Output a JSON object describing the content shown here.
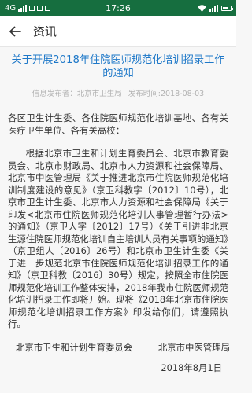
{
  "status_bar": {
    "network": "4G",
    "time": "17:26"
  },
  "app_bar": {
    "title": "资讯"
  },
  "article": {
    "title": "关于开展2018年住院医师规范化培训招录工作的通知",
    "publisher": "信息发布者：北京市卫生局",
    "publish_time": "发布时间:2018-08-03",
    "paragraphs": [
      "各区卫生计生委、各住院医师规范化培训基地、各有关医疗卫生单位、各有关高校：",
      "根据北京市卫生和计划生育委员会、北京市教育委员会、北京市财政局、北京市人力资源和社会保障局、北京市中医管理局《关于推进北京市住院医师规范化培训制度建设的意见》（京卫科教字〔2012〕10号），北京市卫生计生委、北京市人力资源和社会保障局《关于印发<北京市住院医师规范化培训人事管理暂行办法>的通知》（京卫人字〔2012〕17号）《关于引进非北京生源住院医师规范化培训自主培训人员有关事项的通知》（京卫组人〔2016〕26号）和北京市卫生计生委《关于进一步规范北京市住院医师规范化培训招录工作的通知》（京卫科教〔2016〕30号）规定，按照全市住院医师规范化培训工作整体安排，2018年我市住院医师规范化培训招录工作即将开始。现将《2018年北京市住院医师规范化培训招录工作方案》印发给你们，请遵照执行。"
    ],
    "signer_1": "北京市卫生和计划生育委员会",
    "signer_2": "北京市中医管理局",
    "date": "2018年8月1日"
  },
  "colors": {
    "status_bar_bg": "#166e3f",
    "title_blue": "#1e78c8",
    "meta_gray": "#b2b2b2"
  },
  "icons": [
    "back-arrow-icon",
    "signal-icon",
    "wifi-icon",
    "battery-icon"
  ]
}
